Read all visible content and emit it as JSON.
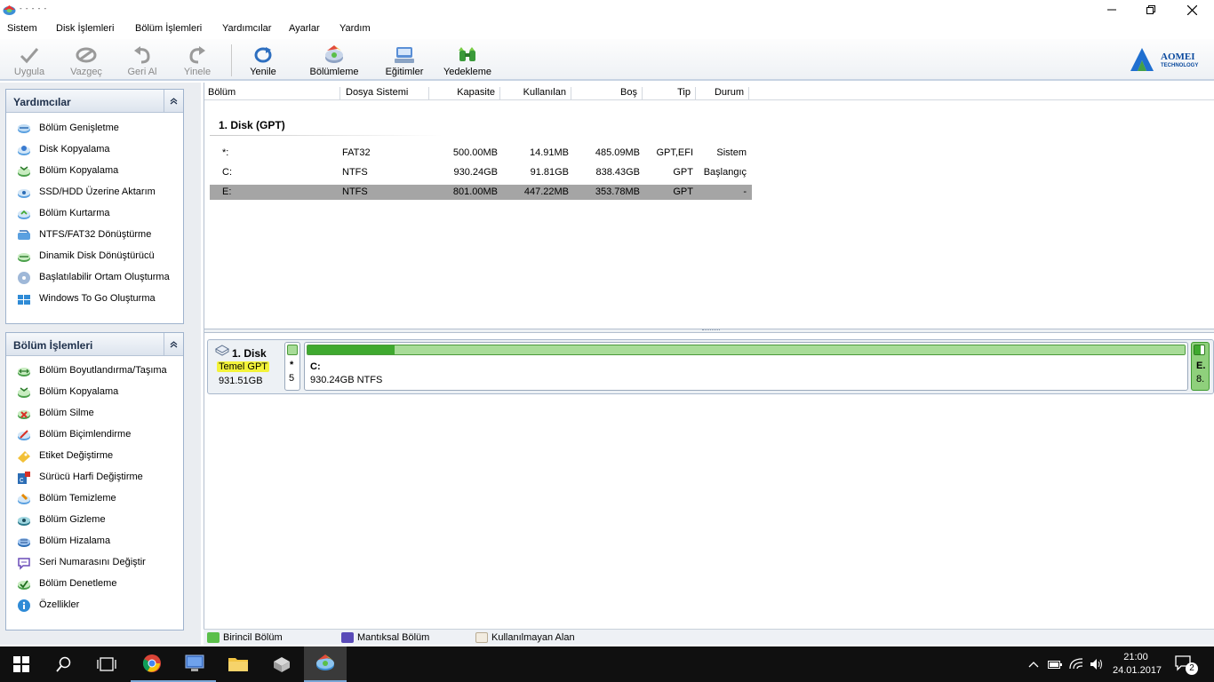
{
  "window": {
    "title": "- - - - -"
  },
  "menu": [
    "Sistem",
    "Disk İşlemleri",
    "Bölüm İşlemleri",
    "Yardımcılar",
    "Ayarlar",
    "Yardım"
  ],
  "toolbar": {
    "apply": "Uygula",
    "discard": "Vazgeç",
    "undo": "Geri Al",
    "redo": "Yinele",
    "refresh": "Yenile",
    "partition": "Bölümleme",
    "tutorials": "Eğitimler",
    "backup": "Yedekleme"
  },
  "brand": {
    "name": "AOMEI",
    "sub": "TECHNOLOGY"
  },
  "helpers_panel": {
    "title": "Yardımcılar",
    "items": [
      {
        "label": "Bölüm Genişletme",
        "icon": "extend-icon"
      },
      {
        "label": "Disk Kopyalama",
        "icon": "disk-copy-icon"
      },
      {
        "label": "Bölüm Kopyalama",
        "icon": "partition-copy-icon"
      },
      {
        "label": "SSD/HDD Üzerine Aktarım",
        "icon": "migrate-icon"
      },
      {
        "label": "Bölüm Kurtarma",
        "icon": "recover-icon"
      },
      {
        "label": "NTFS/FAT32 Dönüştürme",
        "icon": "convert-icon"
      },
      {
        "label": "Dinamik Disk Dönüştürücü",
        "icon": "dynamic-disk-icon"
      },
      {
        "label": "Başlatılabilir Ortam Oluşturma",
        "icon": "bootable-media-icon"
      },
      {
        "label": "Windows To Go Oluşturma",
        "icon": "windows-to-go-icon"
      }
    ]
  },
  "partition_panel": {
    "title": "Bölüm İşlemleri",
    "items": [
      {
        "label": "Bölüm Boyutlandırma/Taşıma",
        "icon": "resize-icon"
      },
      {
        "label": "Bölüm Kopyalama",
        "icon": "partition-copy-icon"
      },
      {
        "label": "Bölüm Silme",
        "icon": "delete-icon"
      },
      {
        "label": "Bölüm Biçimlendirme",
        "icon": "format-icon"
      },
      {
        "label": "Etiket Değiştirme",
        "icon": "label-icon"
      },
      {
        "label": "Sürücü Harfi Değiştirme",
        "icon": "drive-letter-icon"
      },
      {
        "label": "Bölüm Temizleme",
        "icon": "wipe-icon"
      },
      {
        "label": "Bölüm Gizleme",
        "icon": "hide-icon"
      },
      {
        "label": "Bölüm Hizalama",
        "icon": "align-icon"
      },
      {
        "label": "Seri Numarasını Değiştir",
        "icon": "serial-icon"
      },
      {
        "label": "Bölüm Denetleme",
        "icon": "check-icon"
      },
      {
        "label": "Özellikler",
        "icon": "info-icon"
      }
    ]
  },
  "table": {
    "columns": [
      "Bölüm",
      "Dosya Sistemi",
      "Kapasite",
      "Kullanılan",
      "Boş",
      "Tip",
      "Durum"
    ],
    "group": "1. Disk (GPT)",
    "rows": [
      {
        "name": "*:",
        "fs": "FAT32",
        "capacity": "500.00MB",
        "used": "14.91MB",
        "free": "485.09MB",
        "type": "GPT,EFI",
        "status": "Sistem"
      },
      {
        "name": "C:",
        "fs": "NTFS",
        "capacity": "930.24GB",
        "used": "91.81GB",
        "free": "838.43GB",
        "type": "GPT",
        "status": "Başlangıç"
      },
      {
        "name": "E:",
        "fs": "NTFS",
        "capacity": "801.00MB",
        "used": "447.22MB",
        "free": "353.78MB",
        "type": "GPT",
        "status": "-"
      }
    ]
  },
  "disk_map": {
    "disk_name": "1. Disk",
    "disk_type": "Temel GPT",
    "disk_size": "931.51GB",
    "efi_label": "*",
    "efi_sub": "5",
    "c_label": "C:",
    "c_detail": "930.24GB NTFS",
    "c_used_fraction": 0.099,
    "e_label": "E.",
    "e_sub": "8."
  },
  "legend": {
    "primary": "Birincil Bölüm",
    "logical": "Mantıksal Bölüm",
    "unallocated": "Kullanılmayan Alan"
  },
  "colors": {
    "primary": "#5bbf4a",
    "logical": "#5a4bb8",
    "unallocated": "#f2ece0",
    "highlight": "#f3f33a"
  },
  "taskbar": {
    "time": "21:00",
    "date": "24.01.2017",
    "notification_count": "2"
  }
}
